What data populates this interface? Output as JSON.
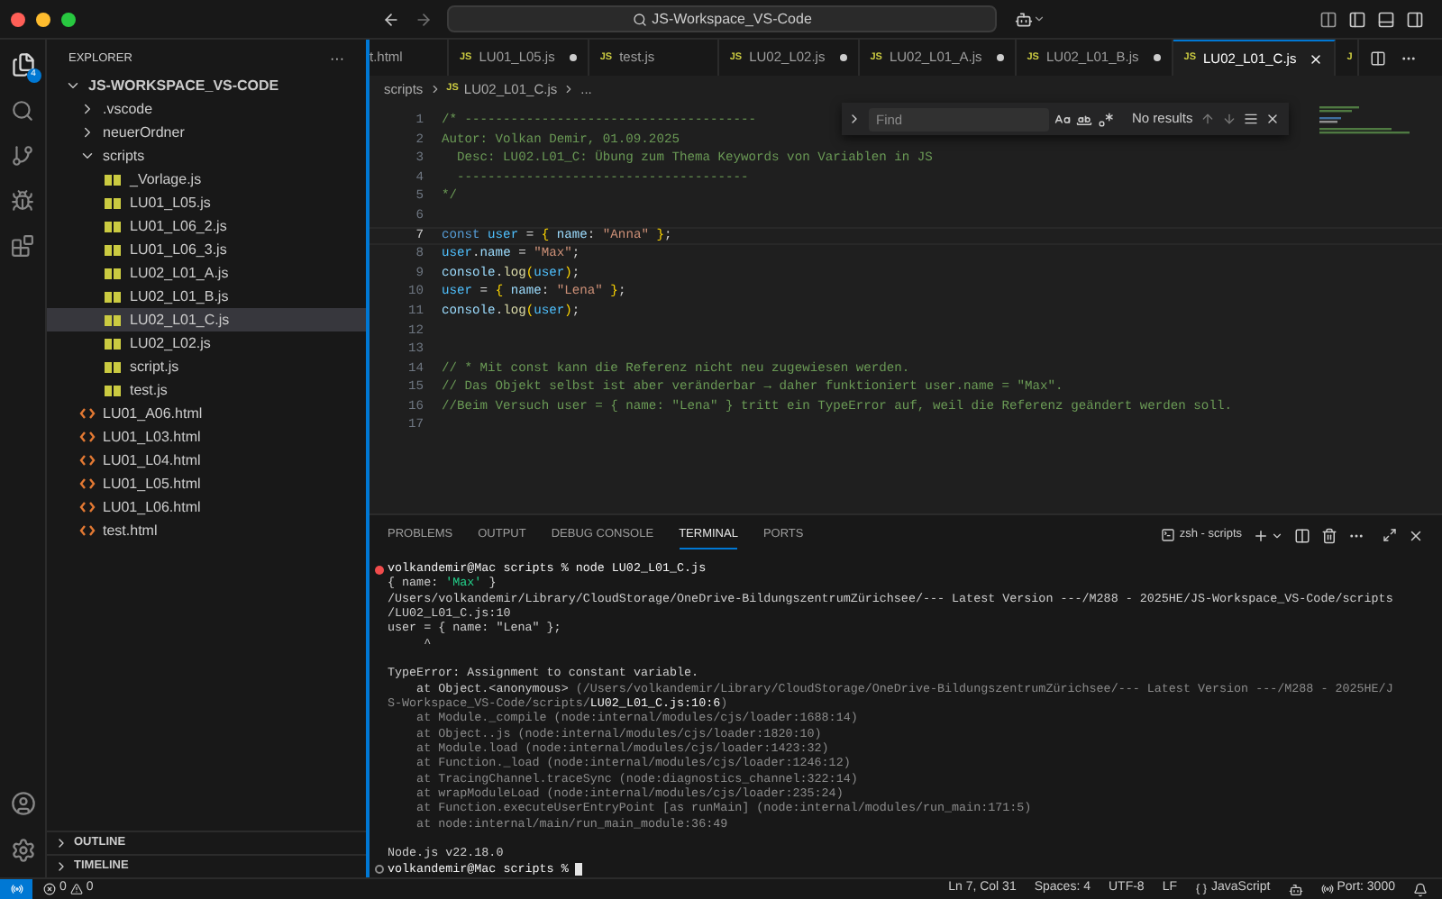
{
  "title_bar": {
    "search": "JS-Workspace_VS-Code"
  },
  "activity_bar": {
    "explorer_badge": "4"
  },
  "sidebar": {
    "title": "EXPLORER",
    "more": "···",
    "tree": [
      {
        "label": "JS-WORKSPACE_VS-CODE",
        "kind": "root",
        "expanded": true,
        "selected": false,
        "children": [
          {
            "label": ".vscode",
            "kind": "folder",
            "expanded": false,
            "selected": false
          },
          {
            "label": "neuerOrdner",
            "kind": "folder",
            "expanded": false,
            "selected": false
          },
          {
            "label": "scripts",
            "kind": "folder",
            "expanded": true,
            "selected": false,
            "children": [
              {
                "label": "_Vorlage.js",
                "kind": "js",
                "selected": false
              },
              {
                "label": "LU01_L05.js",
                "kind": "js",
                "selected": false
              },
              {
                "label": "LU01_L06_2.js",
                "kind": "js",
                "selected": false
              },
              {
                "label": "LU01_L06_3.js",
                "kind": "js",
                "selected": false
              },
              {
                "label": "LU02_L01_A.js",
                "kind": "js",
                "selected": false
              },
              {
                "label": "LU02_L01_B.js",
                "kind": "js",
                "selected": false
              },
              {
                "label": "LU02_L01_C.js",
                "kind": "js",
                "selected": true
              },
              {
                "label": "LU02_L02.js",
                "kind": "js",
                "selected": false
              },
              {
                "label": "script.js",
                "kind": "js",
                "selected": false
              },
              {
                "label": "test.js",
                "kind": "js",
                "selected": false
              }
            ]
          },
          {
            "label": "LU01_A06.html",
            "kind": "html",
            "selected": false
          },
          {
            "label": "LU01_L03.html",
            "kind": "html",
            "selected": false
          },
          {
            "label": "LU01_L04.html",
            "kind": "html",
            "selected": false
          },
          {
            "label": "LU01_L05.html",
            "kind": "html",
            "selected": false
          },
          {
            "label": "LU01_L06.html",
            "kind": "html",
            "selected": false
          },
          {
            "label": "test.html",
            "kind": "html",
            "selected": false
          }
        ]
      }
    ],
    "sections": [
      {
        "label": "OUTLINE",
        "expanded": false
      },
      {
        "label": "TIMELINE",
        "expanded": false
      }
    ]
  },
  "tabs": [
    {
      "label": "t.html",
      "dirty": false,
      "selected": false
    },
    {
      "label": "LU01_L05.js",
      "kind": "js",
      "dirty": true,
      "selected": false,
      "badge": "JS"
    },
    {
      "label": "test.js",
      "kind": "js",
      "dirty": false,
      "selected": false,
      "badge": "JS"
    },
    {
      "label": "LU02_L02.js",
      "kind": "js",
      "dirty": true,
      "selected": false,
      "badge": "JS"
    },
    {
      "label": "LU02_L01_A.js",
      "kind": "js",
      "dirty": true,
      "selected": false,
      "badge": "JS"
    },
    {
      "label": "LU02_L01_B.js",
      "kind": "js",
      "dirty": true,
      "selected": false,
      "badge": "JS"
    },
    {
      "label": "LU02_L01_C.js",
      "kind": "js",
      "dirty": false,
      "selected": true,
      "badge": "JS"
    },
    {
      "kind": "js",
      "selected": false,
      "badge": "J"
    }
  ],
  "breadcrumbs": {
    "folder": "scripts",
    "badge": "JS",
    "file": "LU02_L01_C.js",
    "more": "..."
  },
  "find_widget": {
    "placeholder": "Find",
    "result": "No results"
  },
  "editor": {
    "lines": [
      {
        "number": "1",
        "current": false,
        "tokens": [
          {
            "text": "/* --------------------------------------",
            "kind": "comment"
          }
        ]
      },
      {
        "number": "2",
        "current": false,
        "tokens": [
          {
            "text": "Autor: Volkan Demir, 01.09.2025",
            "kind": "comment"
          }
        ]
      },
      {
        "number": "3",
        "current": false,
        "tokens": [
          {
            "text": "  Desc: LU02.L01_C: Übung zum Thema Keywords von Variablen in JS",
            "kind": "comment"
          }
        ]
      },
      {
        "number": "4",
        "current": false,
        "tokens": [
          {
            "text": "  --------------------------------------",
            "kind": "comment"
          }
        ]
      },
      {
        "number": "5",
        "current": false,
        "tokens": [
          {
            "text": "*/",
            "kind": "comment"
          }
        ]
      },
      {
        "number": "6",
        "current": false
      },
      {
        "number": "7",
        "current": true,
        "tokens": [
          {
            "text": "const ",
            "kind": "keyword"
          },
          {
            "text": "user",
            "kind": "constant"
          },
          {
            "text": " = ",
            "kind": "punct"
          },
          {
            "text": "{ ",
            "kind": "brace"
          },
          {
            "text": "name",
            "kind": "property"
          },
          {
            "text": ": ",
            "kind": "punct"
          },
          {
            "text": "\"Anna\"",
            "kind": "string"
          },
          {
            "text": " }",
            "kind": "brace"
          },
          {
            "text": ";",
            "kind": "punct"
          }
        ]
      },
      {
        "number": "8",
        "current": false,
        "tokens": [
          {
            "text": "user",
            "kind": "constant"
          },
          {
            "text": ".",
            "kind": "punct"
          },
          {
            "text": "name",
            "kind": "property"
          },
          {
            "text": " = ",
            "kind": "punct"
          },
          {
            "text": "\"Max\"",
            "kind": "string"
          },
          {
            "text": ";",
            "kind": "punct"
          }
        ]
      },
      {
        "number": "9",
        "current": false,
        "tokens": [
          {
            "text": "console",
            "kind": "property"
          },
          {
            "text": ".",
            "kind": "punct"
          },
          {
            "text": "log",
            "kind": "function"
          },
          {
            "text": "(",
            "kind": "brace"
          },
          {
            "text": "user",
            "kind": "constant"
          },
          {
            "text": ")",
            "kind": "brace"
          },
          {
            "text": ";",
            "kind": "punct"
          }
        ]
      },
      {
        "number": "10",
        "current": false,
        "tokens": [
          {
            "text": "user",
            "kind": "constant"
          },
          {
            "text": " = ",
            "kind": "punct"
          },
          {
            "text": "{ ",
            "kind": "brace"
          },
          {
            "text": "name",
            "kind": "property"
          },
          {
            "text": ": ",
            "kind": "punct"
          },
          {
            "text": "\"Lena\"",
            "kind": "string"
          },
          {
            "text": " }",
            "kind": "brace"
          },
          {
            "text": ";",
            "kind": "punct"
          }
        ]
      },
      {
        "number": "11",
        "current": false,
        "tokens": [
          {
            "text": "console",
            "kind": "property"
          },
          {
            "text": ".",
            "kind": "punct"
          },
          {
            "text": "log",
            "kind": "function"
          },
          {
            "text": "(",
            "kind": "brace"
          },
          {
            "text": "user",
            "kind": "constant"
          },
          {
            "text": ")",
            "kind": "brace"
          },
          {
            "text": ";",
            "kind": "punct"
          }
        ]
      },
      {
        "number": "12",
        "current": false
      },
      {
        "number": "13",
        "current": false
      },
      {
        "number": "14",
        "current": false,
        "tokens": [
          {
            "text": "// * Mit const kann die Referenz nicht neu zugewiesen werden.",
            "kind": "comment"
          }
        ]
      },
      {
        "number": "15",
        "current": false,
        "tokens": [
          {
            "text": "// Das Objekt selbst ist aber veränderbar → daher funktioniert user.name = \"Max\".",
            "kind": "comment"
          }
        ]
      },
      {
        "number": "16",
        "current": false,
        "tokens": [
          {
            "text": "//Beim Versuch user = { name: \"Lena\" } tritt ein TypeError auf, weil die Referenz geändert werden soll.",
            "kind": "comment"
          }
        ]
      },
      {
        "number": "17",
        "current": false
      }
    ]
  },
  "panel": {
    "tabs": [
      {
        "label": "PROBLEMS",
        "selected": false
      },
      {
        "label": "OUTPUT",
        "selected": false
      },
      {
        "label": "DEBUG CONSOLE",
        "selected": false
      },
      {
        "label": "TERMINAL",
        "selected": true
      },
      {
        "label": "PORTS",
        "selected": false
      }
    ],
    "terminal_name": "zsh - scripts",
    "lines": [
      {
        "kind": "failed",
        "segments": [
          {
            "text": "volkandemir@Mac scripts % node LU02_L01_C.js",
            "kind": "bright"
          }
        ]
      },
      {
        "kind": "output",
        "segments": [
          {
            "text": "{ name: ",
            "kind": "normal"
          },
          {
            "text": "'Max'",
            "kind": "string"
          },
          {
            "text": " }",
            "kind": "normal"
          }
        ]
      },
      {
        "kind": "output",
        "segments": [
          {
            "text": "/Users/volkandemir/Library/CloudStorage/OneDrive-BildungszentrumZürichsee/--- Latest Version ---/M288 - 2025HE/JS-Workspace_VS-Code/scripts",
            "kind": "normal"
          }
        ]
      },
      {
        "kind": "output",
        "segments": [
          {
            "text": "/LU02_L01_C.js:10",
            "kind": "normal"
          }
        ]
      },
      {
        "kind": "output",
        "segments": [
          {
            "text": "user = { name: \"Lena\" };",
            "kind": "normal"
          }
        ]
      },
      {
        "kind": "output",
        "segments": [
          {
            "text": "     ^",
            "kind": "normal"
          }
        ]
      },
      {
        "kind": "blank"
      },
      {
        "kind": "output",
        "segments": [
          {
            "text": "TypeError: Assignment to constant variable.",
            "kind": "normal"
          }
        ]
      },
      {
        "kind": "output",
        "segments": [
          {
            "text": "    at Object.<anonymous> ",
            "kind": "normal"
          },
          {
            "text": "(/Users/volkandemir/Library/CloudStorage/OneDrive-BildungszentrumZürichsee/--- Latest Version ---/M288 - 2025HE/J",
            "kind": "dim"
          }
        ]
      },
      {
        "kind": "output",
        "segments": [
          {
            "text": "S-Workspace_VS-Code/scripts/",
            "kind": "dim"
          },
          {
            "text": "LU02_L01_C.js:10:6",
            "kind": "bright"
          },
          {
            "text": ")",
            "kind": "dim"
          }
        ]
      },
      {
        "kind": "output",
        "segments": [
          {
            "text": "    at Module._compile (node:internal/modules/cjs/loader:1688:14)",
            "kind": "dim"
          }
        ]
      },
      {
        "kind": "output",
        "segments": [
          {
            "text": "    at Object..js (node:internal/modules/cjs/loader:1820:10)",
            "kind": "dim"
          }
        ]
      },
      {
        "kind": "output",
        "segments": [
          {
            "text": "    at Module.load (node:internal/modules/cjs/loader:1423:32)",
            "kind": "dim"
          }
        ]
      },
      {
        "kind": "output",
        "segments": [
          {
            "text": "    at Function._load (node:internal/modules/cjs/loader:1246:12)",
            "kind": "dim"
          }
        ]
      },
      {
        "kind": "output",
        "segments": [
          {
            "text": "    at TracingChannel.traceSync (node:diagnostics_channel:322:14)",
            "kind": "dim"
          }
        ]
      },
      {
        "kind": "output",
        "segments": [
          {
            "text": "    at wrapModuleLoad (node:internal/modules/cjs/loader:235:24)",
            "kind": "dim"
          }
        ]
      },
      {
        "kind": "output",
        "segments": [
          {
            "text": "    at Function.executeUserEntryPoint [as runMain] (node:internal/modules/run_main:171:5)",
            "kind": "dim"
          }
        ]
      },
      {
        "kind": "output",
        "segments": [
          {
            "text": "    at node:internal/main/run_main_module:36:49",
            "kind": "dim"
          }
        ]
      },
      {
        "kind": "blank"
      },
      {
        "kind": "output",
        "segments": [
          {
            "text": "Node.js v22.18.0",
            "kind": "normal"
          }
        ]
      },
      {
        "kind": "prompt",
        "cursor": true,
        "segments": [
          {
            "text": "volkandemir@Mac scripts % ",
            "kind": "bright"
          }
        ]
      }
    ]
  },
  "status_bar": {
    "errors": "0",
    "warnings": "0",
    "position": "Ln 7, Col 31",
    "spaces": "Spaces: 4",
    "encoding": "UTF-8",
    "eol": "LF",
    "language": "JavaScript",
    "port": "Port: 3000"
  }
}
